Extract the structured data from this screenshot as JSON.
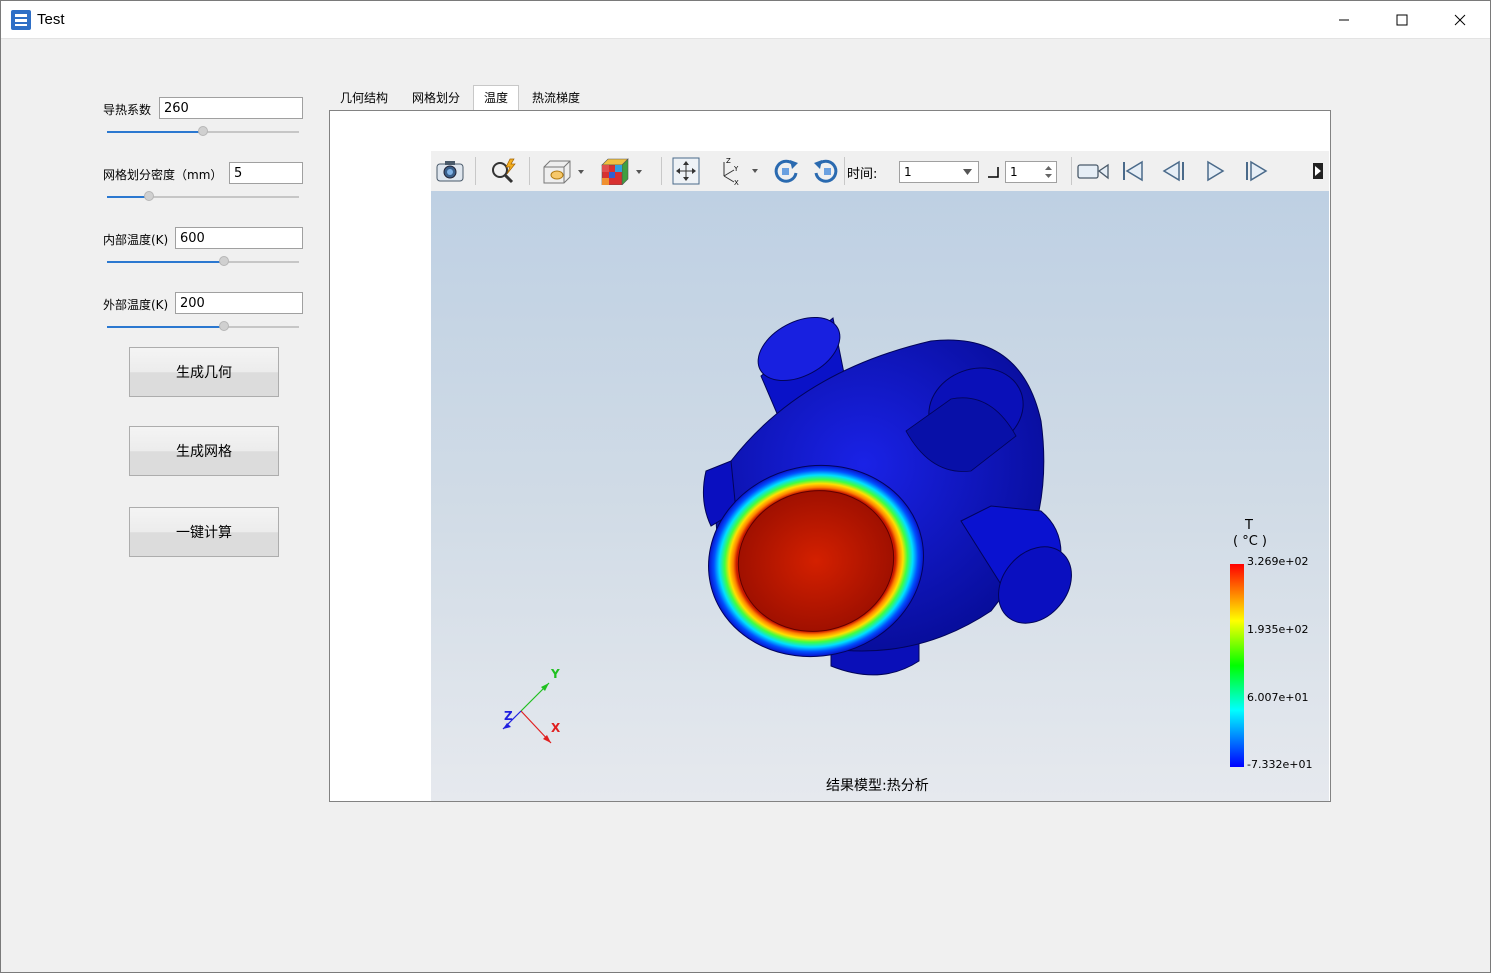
{
  "window": {
    "title": "Test"
  },
  "params": {
    "thermal_conductivity": {
      "label": "导热系数",
      "value": "260",
      "slider_fraction": 0.5
    },
    "mesh_density": {
      "label": "网格划分密度（mm）",
      "value": "5",
      "slider_fraction": 0.22
    },
    "inner_temp": {
      "label": "内部温度(K)",
      "value": "600",
      "slider_fraction": 0.61
    },
    "outer_temp": {
      "label": "外部温度(K)",
      "value": "200",
      "slider_fraction": 0.61
    }
  },
  "buttons": {
    "generate_geometry": "生成几何",
    "generate_mesh": "生成网格",
    "one_click_compute": "一键计算"
  },
  "tabs": [
    {
      "label": "几何结构",
      "active": false
    },
    {
      "label": "网格划分",
      "active": false
    },
    {
      "label": "温度",
      "active": true
    },
    {
      "label": "热流梯度",
      "active": false
    }
  ],
  "toolbar": {
    "time_label": "时间:",
    "time_combo_value": "1",
    "step_value": "1",
    "icons": [
      "camera-icon",
      "zoom-icon",
      "clip-box-icon",
      "color-cube-icon",
      "fit-view-icon",
      "axes-icon",
      "rotate-cw-icon",
      "rotate-ccw-icon",
      "video-icon",
      "first-frame-icon",
      "prev-frame-icon",
      "play-icon",
      "next-frame-icon",
      "more-icon"
    ]
  },
  "viewer": {
    "caption": "结果模型:热分析",
    "axis_labels": {
      "x": "X",
      "y": "Y",
      "z": "Z"
    },
    "legend": {
      "title": "T",
      "unit": "( °C )",
      "ticks": [
        "3.269e+02",
        "1.935e+02",
        "6.007e+01",
        "-7.332e+01"
      ],
      "colors": [
        "#ff0000",
        "#ffff00",
        "#00ff00",
        "#00ffff",
        "#0000ff"
      ]
    }
  },
  "colors": {
    "accent": "#2b78d0",
    "model_blue": "#0a0fc8",
    "hot_red": "#c81800"
  }
}
